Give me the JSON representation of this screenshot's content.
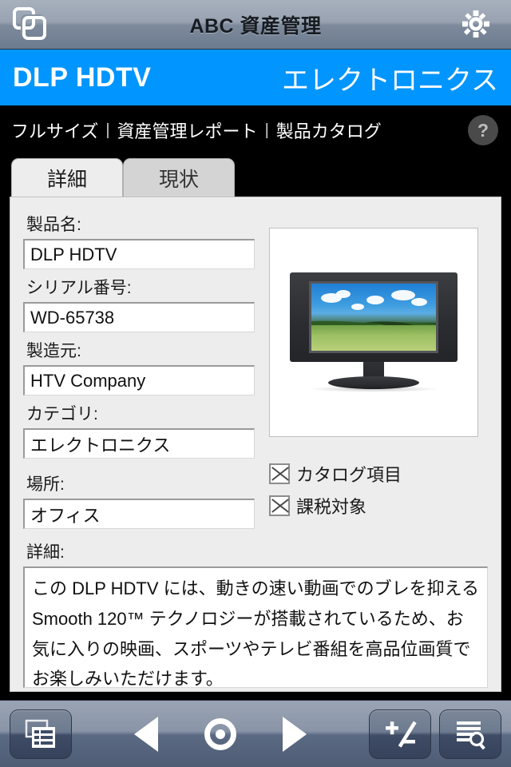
{
  "app": {
    "title": "ABC 資産管理",
    "left_icon": "copy-windows-icon",
    "right_icon": "gear-icon"
  },
  "product_header": {
    "name": "DLP HDTV",
    "category": "エレクトロニクス",
    "background_color": "#0095ff"
  },
  "breadcrumb": {
    "items": [
      "フルサイズ",
      "資産管理レポート",
      "製品カタログ"
    ],
    "separator": "|",
    "help_label": "?"
  },
  "tabs": [
    {
      "label": "詳細",
      "active": true
    },
    {
      "label": "現状",
      "active": false
    }
  ],
  "form": {
    "fields": [
      {
        "label": "製品名:",
        "value": "DLP HDTV"
      },
      {
        "label": "シリアル番号:",
        "value": "WD-65738"
      },
      {
        "label": "製造元:",
        "value": "HTV Company"
      },
      {
        "label": "カテゴリ:",
        "value": "エレクトロニクス"
      },
      {
        "label": "場所:",
        "value": "オフィス"
      }
    ],
    "description": {
      "label": "詳細:",
      "value": "この DLP HDTV には、動きの速い動画でのブレを抑える Smooth 120™ テクノロジーが搭載されているため、お気に入りの映画、スポーツやテレビ番組を高品位画質でお楽しみいただけます。"
    },
    "checkboxes": [
      {
        "label": "カタログ項目",
        "checked": true
      },
      {
        "label": "課税対象",
        "checked": true
      }
    ]
  },
  "product_image": {
    "alt": "DLP HDTV 製品画像"
  },
  "toolbar": {
    "buttons": [
      {
        "name": "report-list-button",
        "icon": "report-list-icon"
      },
      {
        "name": "previous-button",
        "icon": "triangle-left-icon"
      },
      {
        "name": "record-button",
        "icon": "ring-circle-icon"
      },
      {
        "name": "next-button",
        "icon": "triangle-right-icon"
      },
      {
        "name": "add-remove-button",
        "icon": "plus-minus-icon"
      },
      {
        "name": "find-button",
        "icon": "list-search-icon"
      }
    ]
  },
  "colors": {
    "accent_blue": "#0095ff",
    "panel_bg": "#ededed",
    "tab_active": "#ededed",
    "tab_inactive": "#d4d4d4",
    "chrome_top": "#98a2b1",
    "chrome_bottom": "#4e5c74"
  }
}
